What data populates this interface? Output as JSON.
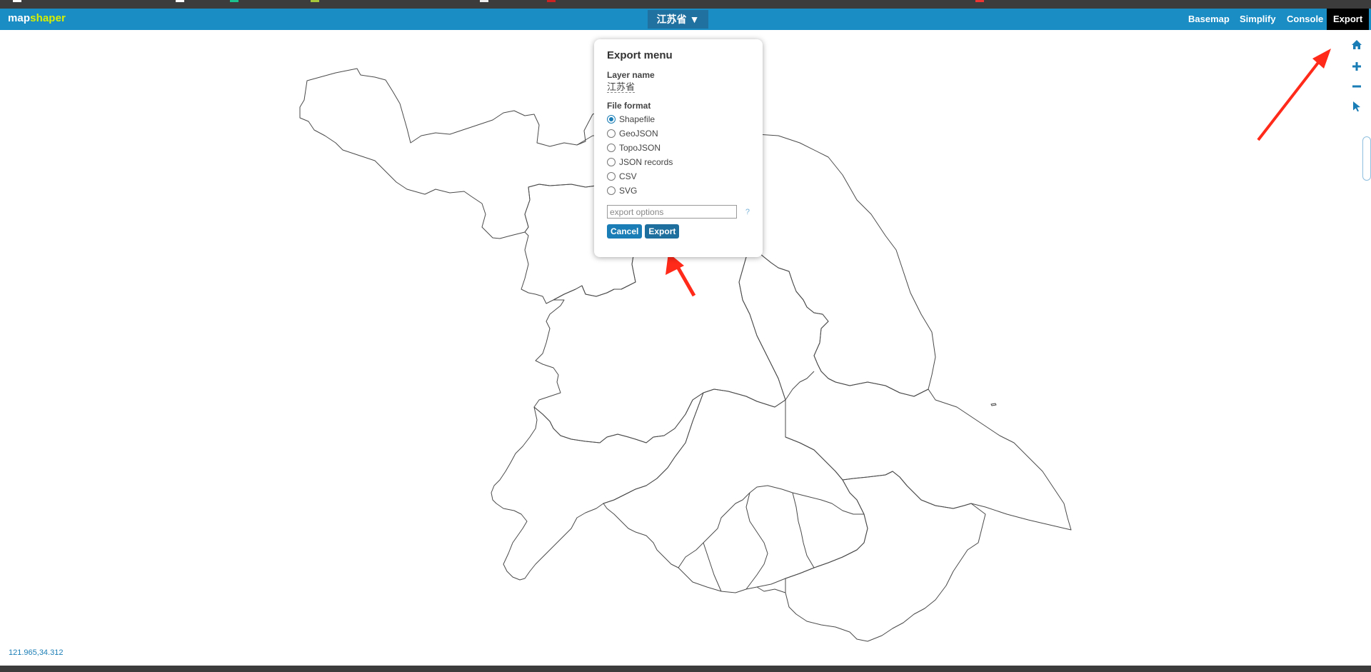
{
  "app": {
    "logo_part1": "map",
    "logo_part2": "shaper",
    "layer_selector": "江苏省",
    "layer_caret": "▼"
  },
  "menu": [
    {
      "label": "Basemap"
    },
    {
      "label": "Simplify"
    },
    {
      "label": "Console"
    },
    {
      "label": "Export"
    }
  ],
  "tools": [
    "home-icon",
    "zoom-in-icon",
    "zoom-out-icon",
    "pointer-icon"
  ],
  "export_dialog": {
    "title": "Export menu",
    "layer_name_label": "Layer name",
    "layer_name": "江苏省",
    "file_format_label": "File format",
    "formats": [
      "Shapefile",
      "GeoJSON",
      "TopoJSON",
      "JSON records",
      "CSV",
      "SVG"
    ],
    "selected_format": "Shapefile",
    "options_placeholder": "export options",
    "help": "?",
    "cancel_label": "Cancel",
    "export_label": "Export"
  },
  "status": {
    "coordinates": "121.965,34.312"
  },
  "colors": {
    "header": "#1a8dc4",
    "accent": "#d8f000",
    "annotation_arrow": "#ff2a1a"
  }
}
